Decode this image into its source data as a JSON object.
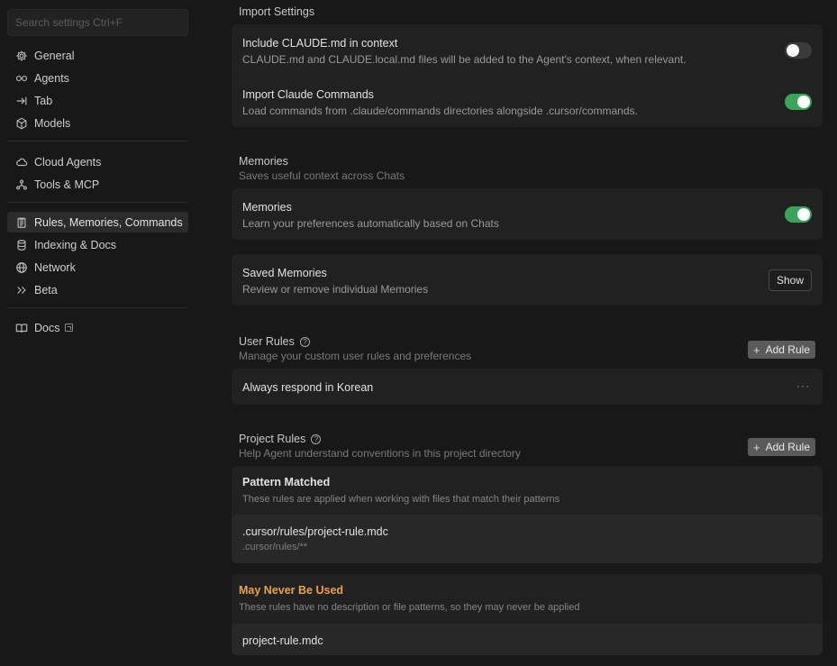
{
  "sidebar": {
    "search_placeholder": "Search settings Ctrl+F",
    "group1": [
      {
        "label": "General",
        "icon": "gear-icon"
      },
      {
        "label": "Agents",
        "icon": "infinity-icon"
      },
      {
        "label": "Tab",
        "icon": "tab-arrow-icon"
      },
      {
        "label": "Models",
        "icon": "cube-icon"
      }
    ],
    "group2": [
      {
        "label": "Cloud Agents",
        "icon": "cloud-icon"
      },
      {
        "label": "Tools & MCP",
        "icon": "tools-icon"
      }
    ],
    "group3": [
      {
        "label": "Rules, Memories, Commands",
        "icon": "clipboard-icon",
        "active": true
      },
      {
        "label": "Indexing & Docs",
        "icon": "database-icon"
      },
      {
        "label": "Network",
        "icon": "globe-icon"
      },
      {
        "label": "Beta",
        "icon": "chevrons-right-icon"
      }
    ],
    "group4": [
      {
        "label": "Docs",
        "icon": "book-icon"
      }
    ]
  },
  "import": {
    "title": "Import Settings",
    "claude_md": {
      "title": "Include CLAUDE.md in context",
      "desc": "CLAUDE.md and CLAUDE.local.md files will be added to the Agent's context, when relevant.",
      "enabled": false
    },
    "claude_commands": {
      "title": "Import Claude Commands",
      "desc": "Load commands from .claude/commands directories alongside .cursor/commands.",
      "enabled": true
    }
  },
  "memories": {
    "title": "Memories",
    "sub": "Saves useful context across Chats",
    "toggle": {
      "title": "Memories",
      "desc": "Learn your preferences automatically based on Chats",
      "enabled": true
    },
    "saved": {
      "title": "Saved Memories",
      "desc": "Review or remove individual Memories",
      "button": "Show"
    }
  },
  "user_rules": {
    "title": "User Rules",
    "sub": "Manage your custom user rules and preferences",
    "add": "Add Rule",
    "items": [
      "Always respond in Korean"
    ],
    "more": "···"
  },
  "project_rules": {
    "title": "Project Rules",
    "sub": "Help Agent understand conventions in this project directory",
    "add": "Add Rule",
    "pattern": {
      "title": "Pattern Matched",
      "desc": "These rules are applied when working with files that match their patterns",
      "rule_path": ".cursor/rules/project-rule.mdc",
      "rule_glob": ".cursor/rules/**"
    },
    "never": {
      "title": "May Never Be Used",
      "desc": "These rules have no description or file patterns, so they may never be applied",
      "rule": "project-rule.mdc"
    }
  },
  "colors": {
    "toggle_on": "#3ca35a",
    "warning": "#e8a24a"
  }
}
